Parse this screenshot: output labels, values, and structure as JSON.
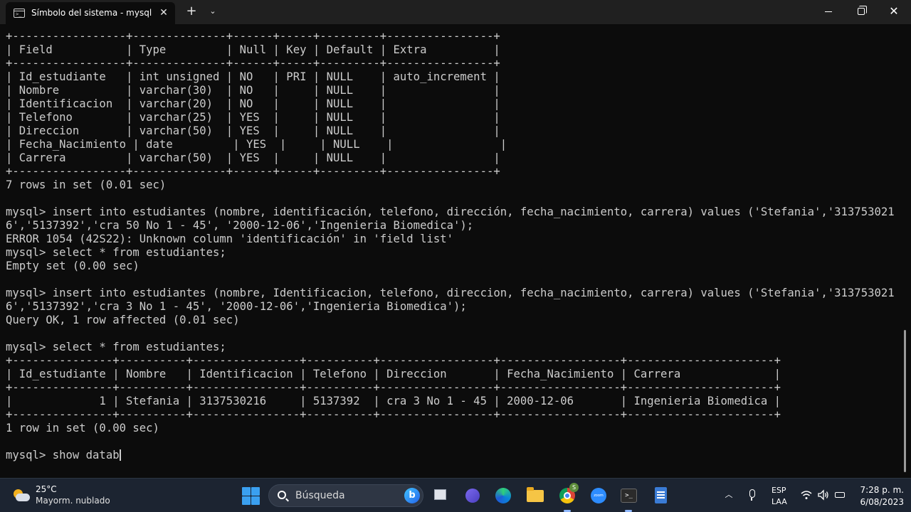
{
  "window": {
    "tab_title": "Símbolo del sistema - mysql",
    "tab_icon_text": ">_"
  },
  "terminal": {
    "lines": [
      "+-----------------+--------------+------+-----+---------+----------------+",
      "| Field           | Type         | Null | Key | Default | Extra          |",
      "+-----------------+--------------+------+-----+---------+----------------+",
      "| Id_estudiante   | int unsigned | NO   | PRI | NULL    | auto_increment |",
      "| Nombre          | varchar(30)  | NO   |     | NULL    |                |",
      "| Identificacion  | varchar(20)  | NO   |     | NULL    |                |",
      "| Telefono        | varchar(25)  | YES  |     | NULL    |                |",
      "| Direccion       | varchar(50)  | YES  |     | NULL    |                |",
      "| Fecha_Nacimiento | date         | YES  |     | NULL    |                |",
      "| Carrera         | varchar(50)  | YES  |     | NULL    |                |",
      "+-----------------+--------------+------+-----+---------+----------------+",
      "7 rows in set (0.01 sec)",
      "",
      "mysql> insert into estudiantes (nombre, identificación, telefono, dirección, fecha_nacimiento, carrera) values ('Stefania','313753021",
      "6','5137392','cra 50 No 1 - 45', '2000-12-06','Ingenieria Biomedica');",
      "ERROR 1054 (42S22): Unknown column 'identificación' in 'field list'",
      "mysql> select * from estudiantes;",
      "Empty set (0.00 sec)",
      "",
      "mysql> insert into estudiantes (nombre, Identificacion, telefono, direccion, fecha_nacimiento, carrera) values ('Stefania','313753021",
      "6','5137392','cra 3 No 1 - 45', '2000-12-06','Ingenieria Biomedica');",
      "Query OK, 1 row affected (0.01 sec)",
      "",
      "mysql> select * from estudiantes;",
      "+---------------+----------+----------------+----------+-----------------+------------------+----------------------+",
      "| Id_estudiante | Nombre   | Identificacion | Telefono | Direccion       | Fecha_Nacimiento | Carrera              |",
      "+---------------+----------+----------------+----------+-----------------+------------------+----------------------+",
      "|             1 | Stefania | 3137530216     | 5137392  | cra 3 No 1 - 45 | 2000-12-06       | Ingenieria Biomedica |",
      "+---------------+----------+----------------+----------+-----------------+------------------+----------------------+",
      "1 row in set (0.00 sec)",
      "",
      "mysql> show datab"
    ]
  },
  "taskbar": {
    "weather_temp": "25°C",
    "weather_cond": "Mayorm. nublado",
    "search_placeholder": "Búsqueda",
    "bing_label": "b",
    "chrome_badge": "S",
    "zoom_label": "zoom",
    "terminal_icon_text": ">_",
    "lang_primary": "ESP",
    "lang_secondary": "LAA",
    "time": "7:28 p. m.",
    "date": "6/08/2023"
  },
  "colors": {
    "terminal_bg": "#0c0c0c",
    "terminal_text": "#cccccc",
    "titlebar_bg": "#202020",
    "taskbar_bg": "#1c2431"
  }
}
